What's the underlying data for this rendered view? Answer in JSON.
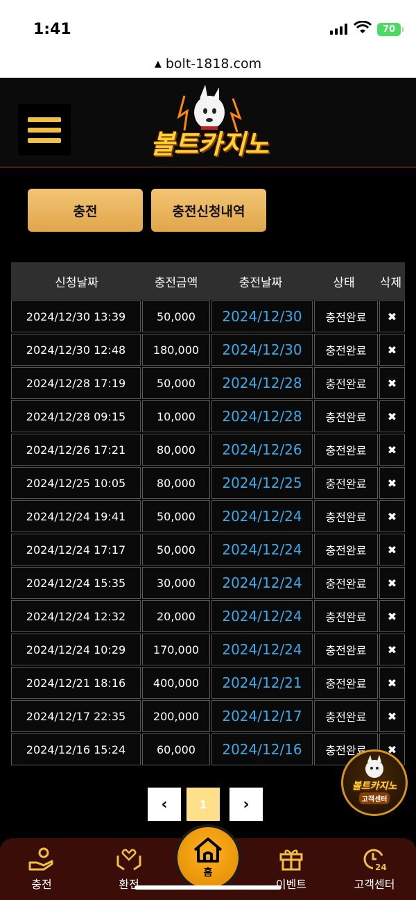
{
  "status_bar": {
    "time": "1:41",
    "battery": "70"
  },
  "browser": {
    "url": "bolt-1818.com"
  },
  "header": {
    "logo_text": "볼트카지노"
  },
  "tabs": [
    {
      "label": "충전"
    },
    {
      "label": "충전신청내역"
    }
  ],
  "table": {
    "headers": [
      "신청날짜",
      "충전금액",
      "충전날짜",
      "상태",
      "삭제"
    ],
    "rows": [
      {
        "request_date": "2024/12/30 13:39",
        "amount": "50,000",
        "charge_date": "2024/12/30",
        "status": "충전완료"
      },
      {
        "request_date": "2024/12/30 12:48",
        "amount": "180,000",
        "charge_date": "2024/12/30",
        "status": "충전완료"
      },
      {
        "request_date": "2024/12/28 17:19",
        "amount": "50,000",
        "charge_date": "2024/12/28",
        "status": "충전완료"
      },
      {
        "request_date": "2024/12/28 09:15",
        "amount": "10,000",
        "charge_date": "2024/12/28",
        "status": "충전완료"
      },
      {
        "request_date": "2024/12/26 17:21",
        "amount": "80,000",
        "charge_date": "2024/12/26",
        "status": "충전완료"
      },
      {
        "request_date": "2024/12/25 10:05",
        "amount": "80,000",
        "charge_date": "2024/12/25",
        "status": "충전완료"
      },
      {
        "request_date": "2024/12/24 19:41",
        "amount": "50,000",
        "charge_date": "2024/12/24",
        "status": "충전완료"
      },
      {
        "request_date": "2024/12/24 17:17",
        "amount": "50,000",
        "charge_date": "2024/12/24",
        "status": "충전완료"
      },
      {
        "request_date": "2024/12/24 15:35",
        "amount": "30,000",
        "charge_date": "2024/12/24",
        "status": "충전완료"
      },
      {
        "request_date": "2024/12/24 12:32",
        "amount": "20,000",
        "charge_date": "2024/12/24",
        "status": "충전완료"
      },
      {
        "request_date": "2024/12/24 10:29",
        "amount": "170,000",
        "charge_date": "2024/12/24",
        "status": "충전완료"
      },
      {
        "request_date": "2024/12/21 18:16",
        "amount": "400,000",
        "charge_date": "2024/12/21",
        "status": "충전완료"
      },
      {
        "request_date": "2024/12/17 22:35",
        "amount": "200,000",
        "charge_date": "2024/12/17",
        "status": "충전완료"
      },
      {
        "request_date": "2024/12/16 15:24",
        "amount": "60,000",
        "charge_date": "2024/12/16",
        "status": "충전완료"
      }
    ],
    "delete_glyph": "✖"
  },
  "pagination": {
    "prev": "‹",
    "current": "1",
    "next": "›"
  },
  "support_badge": {
    "line1": "볼트카지노",
    "line2": "고객센터"
  },
  "bottom_nav": {
    "charge": "충전",
    "exchange": "환전",
    "home": "홈",
    "event": "이벤트",
    "support": "고객센터"
  },
  "colors": {
    "accent": "#f0c043",
    "link_blue": "#3da9e6",
    "nav_bg": "#3a0d08",
    "home_orange": "#ffb11f"
  }
}
